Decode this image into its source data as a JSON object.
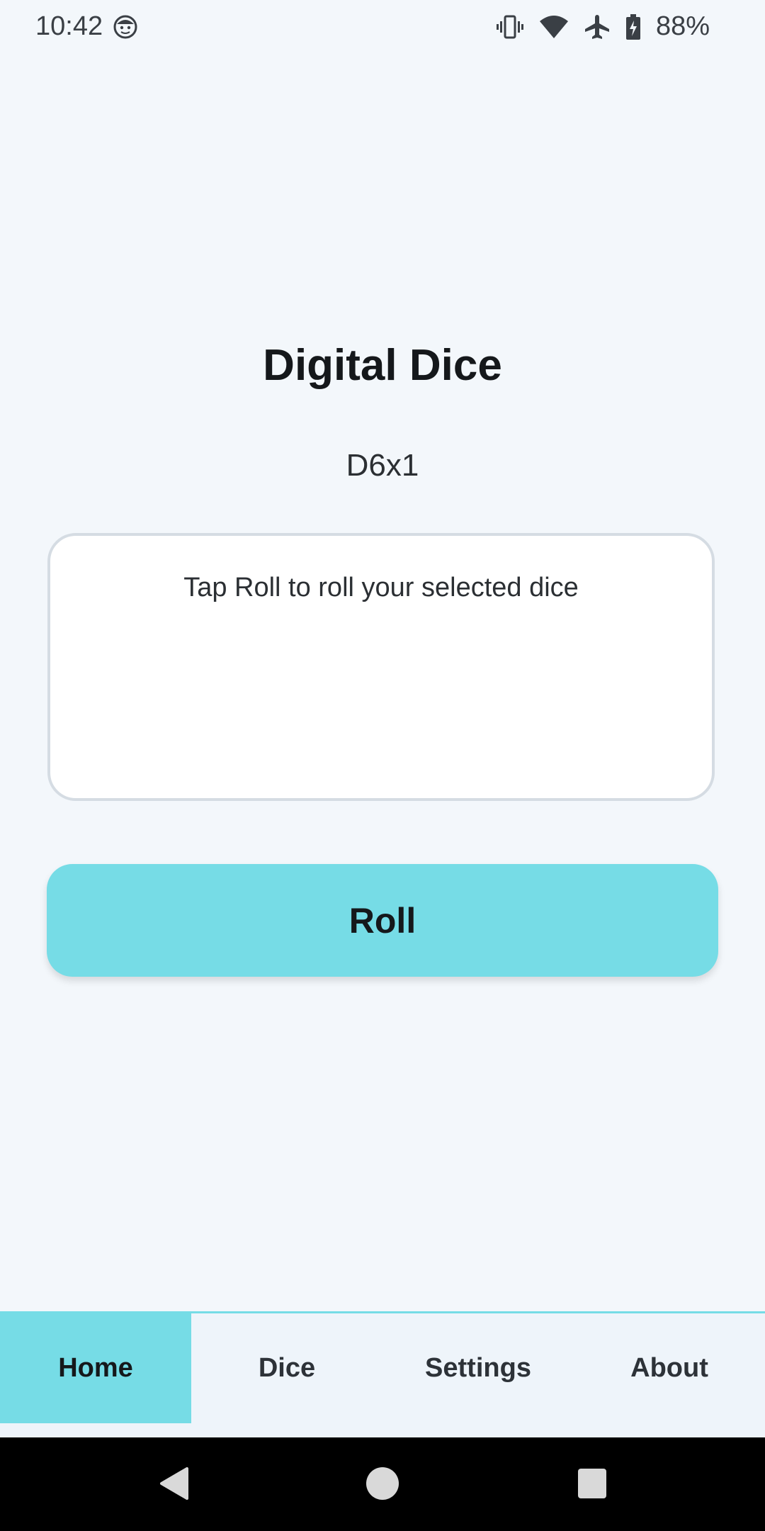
{
  "status_bar": {
    "time": "10:42",
    "battery": "88%",
    "icons": [
      "face-icon",
      "vibrate-icon",
      "wifi-icon",
      "airplane-icon",
      "battery-charging-icon"
    ]
  },
  "main": {
    "title": "Digital Dice",
    "dice_selection": "D6x1",
    "result_placeholder": "Tap Roll to roll your selected dice",
    "roll_label": "Roll"
  },
  "bottom_nav": {
    "items": [
      {
        "label": "Home",
        "active": true
      },
      {
        "label": "Dice",
        "active": false
      },
      {
        "label": "Settings",
        "active": false
      },
      {
        "label": "About",
        "active": false
      }
    ]
  },
  "colors": {
    "accent": "#76dce6",
    "background": "#f3f7fb",
    "nav_background": "#eef4fa",
    "result_border": "#d5dce3"
  },
  "system_nav": {
    "icons": [
      "back-icon",
      "home-icon",
      "recents-icon"
    ]
  }
}
